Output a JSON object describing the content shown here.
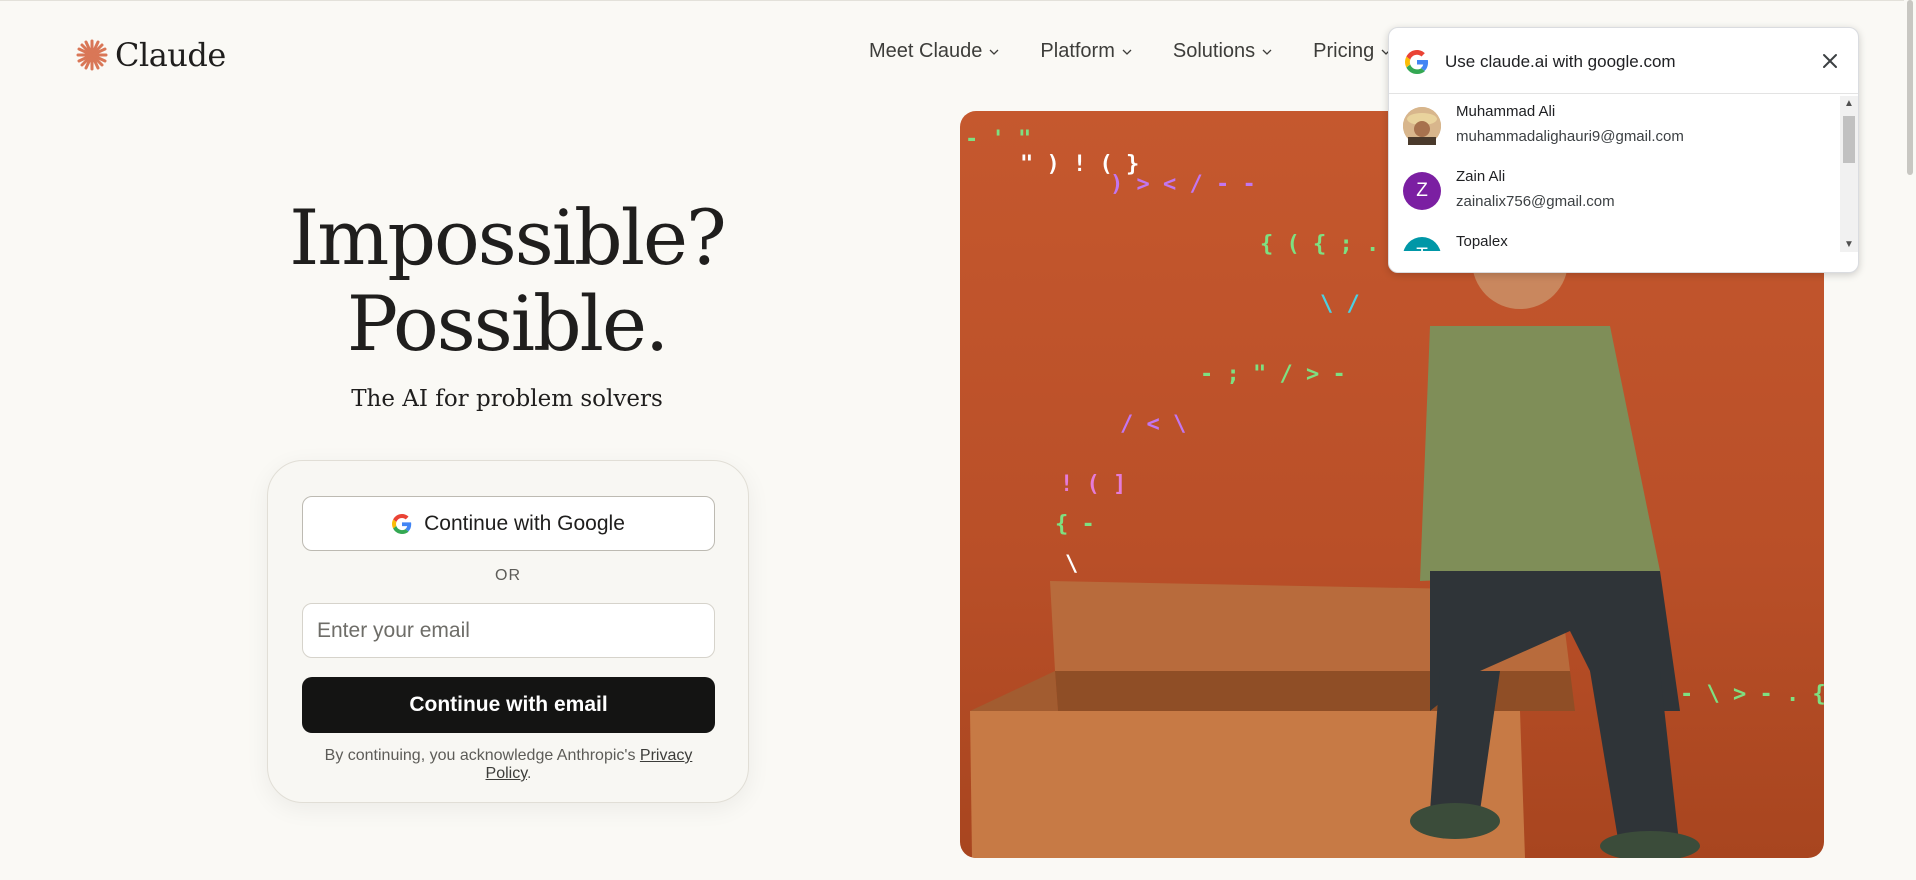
{
  "brand": {
    "name": "Claude",
    "accent": "#d97757"
  },
  "nav": {
    "items": [
      {
        "label": "Meet Claude"
      },
      {
        "label": "Platform"
      },
      {
        "label": "Solutions"
      },
      {
        "label": "Pricing"
      }
    ]
  },
  "hero": {
    "title_line1": "Impossible?",
    "title_line2": "Possible.",
    "subtitle": "The AI for problem solvers"
  },
  "login": {
    "google_button": "Continue with Google",
    "or": "OR",
    "email_placeholder": "Enter your email",
    "email_value": "",
    "email_button": "Continue with email",
    "legal_prefix": "By continuing, you acknowledge Anthropic's ",
    "legal_link": "Privacy Policy",
    "legal_suffix": "."
  },
  "google_popup": {
    "title": "Use claude.ai with google.com",
    "accounts": [
      {
        "name": "Muhammad Ali",
        "email": "muhammadalighauri9@gmail.com",
        "initial": "",
        "color": "#c4a27a"
      },
      {
        "name": "Zain Ali",
        "email": "zainalix756@gmail.com",
        "initial": "Z",
        "color": "#7b1fa2"
      },
      {
        "name": "Topalex",
        "email": "",
        "initial": "T",
        "color": "#0097a7"
      }
    ]
  }
}
